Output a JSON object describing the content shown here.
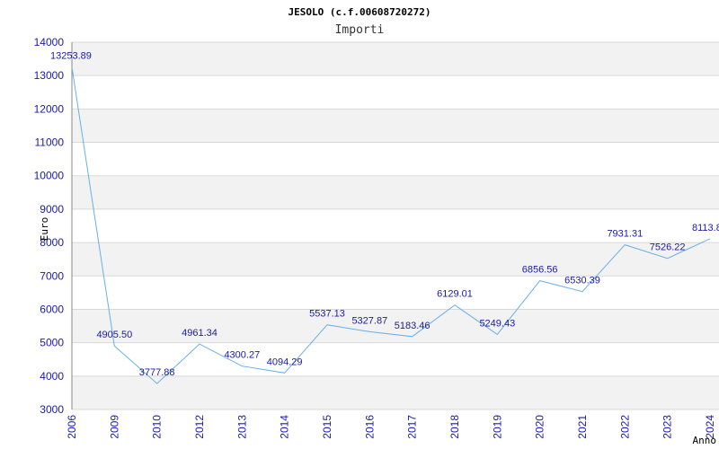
{
  "chart_data": {
    "type": "line",
    "title": "JESOLO (c.f.00608720272)",
    "subtitle": "Importi",
    "xlabel": "Anno",
    "ylabel": "Euro",
    "ylim": [
      3000,
      14000
    ],
    "yticks": [
      3000,
      4000,
      5000,
      6000,
      7000,
      8000,
      9000,
      10000,
      11000,
      12000,
      13000,
      14000
    ],
    "grid": "horizontal alternating bands",
    "categories": [
      "2006",
      "2009",
      "2010",
      "2012",
      "2013",
      "2014",
      "2015",
      "2016",
      "2017",
      "2018",
      "2019",
      "2020",
      "2021",
      "2022",
      "2023",
      "2024"
    ],
    "series": [
      {
        "values": [
          13253.89,
          4905.5,
          3777.88,
          4961.34,
          4300.27,
          4094.29,
          5537.13,
          5327.87,
          5183.46,
          6129.01,
          5249.43,
          6856.56,
          6530.39,
          7931.31,
          7526.22,
          8113.8
        ],
        "labels": [
          "13253.89",
          "4905.50",
          "3777.88",
          "4961.34",
          "4300.27",
          "4094.29",
          "5537.13",
          "5327.87",
          "5183.46",
          "6129.01",
          "5249.43",
          "6856.56",
          "6530.39",
          "7931.31",
          "7526.22",
          "8113.8"
        ],
        "color": "#6aaee8"
      }
    ]
  },
  "colors": {
    "band": "#f2f2f2",
    "grid": "#d8d8d8",
    "text": "#1a1aa6"
  }
}
